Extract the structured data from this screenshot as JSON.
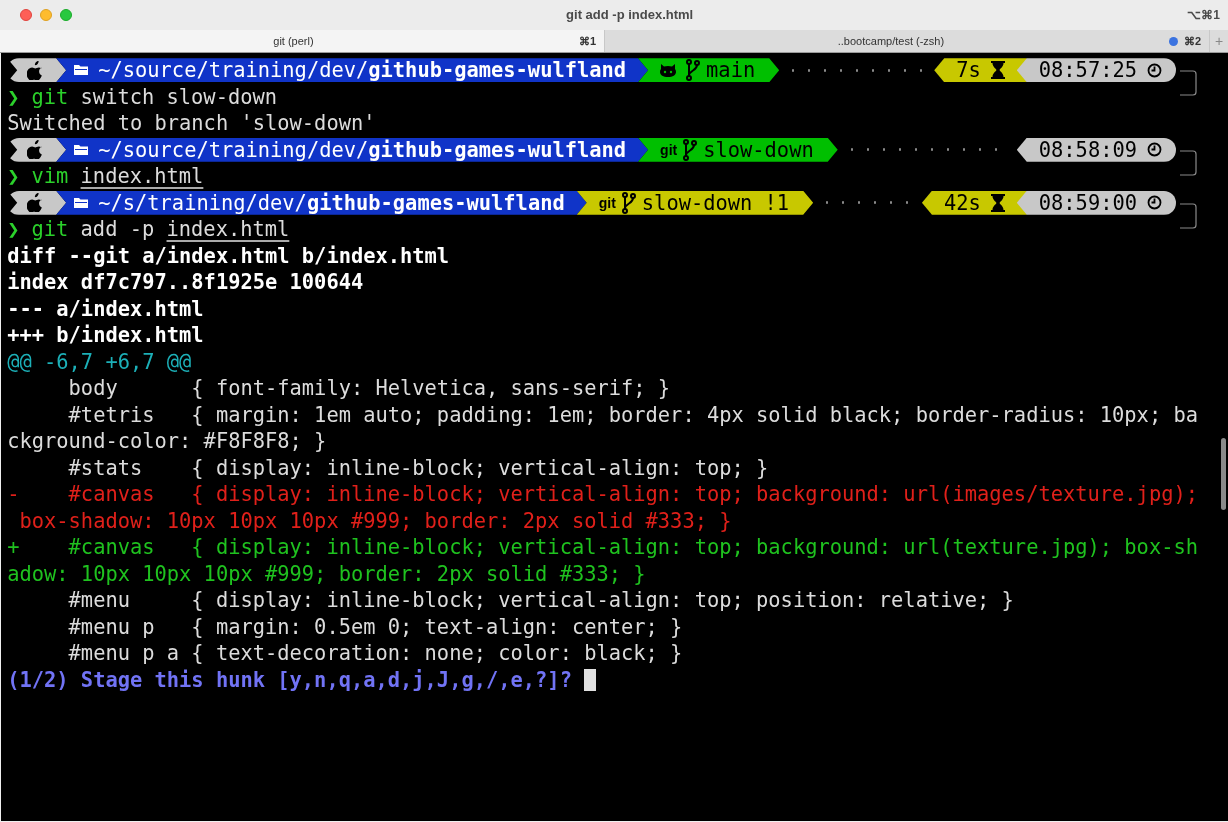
{
  "window": {
    "title": "git add -p index.html",
    "shortcut": "⌥⌘1"
  },
  "tabs": [
    {
      "label": "git (perl)",
      "shortcut": "⌘1",
      "selected": true,
      "activity": false
    },
    {
      "label": "..bootcamp/test (-zsh)",
      "shortcut": "⌘2",
      "selected": false,
      "activity": true
    }
  ],
  "new_tab": "+",
  "lines": [
    {
      "kind": "prompt",
      "path": "~/source/training/dev/**github-games-wulfland**",
      "vcs": {
        "kind": "github"
      },
      "branch": "main",
      "dirty": false,
      "duration": "7s",
      "time": "08:57:25"
    },
    {
      "kind": "command",
      "symbol": "❯",
      "program": "git",
      "args": "switch slow-down"
    },
    {
      "kind": "plain",
      "text": "Switched to branch 'slow-down'"
    },
    {
      "kind": "prompt",
      "path": "~/source/training/dev/**github-games-wulfland**",
      "vcs": {
        "kind": "text",
        "text": "git"
      },
      "branch": "slow-down",
      "dirty": false,
      "time": "08:58:09"
    },
    {
      "kind": "command",
      "symbol": "❯",
      "program": "vim",
      "file": "index.html"
    },
    {
      "kind": "prompt",
      "path": "~/s/training/dev/**github-games-wulfland**",
      "vcs": {
        "kind": "text",
        "text": "git"
      },
      "branch": "slow-down !1",
      "dirty": true,
      "duration": "42s",
      "time": "08:59:00"
    },
    {
      "kind": "command",
      "symbol": "❯",
      "program": "git",
      "args": "add -p",
      "file": "index.html"
    },
    {
      "kind": "bold",
      "text": "diff --git a/index.html b/index.html"
    },
    {
      "kind": "bold",
      "text": "index df7c797..8f1925e 100644"
    },
    {
      "kind": "bold",
      "text": "--- a/index.html"
    },
    {
      "kind": "bold",
      "text": "+++ b/index.html"
    },
    {
      "kind": "hunk",
      "text": "@@ -6,7 +6,7 @@"
    },
    {
      "kind": "plain",
      "text": "     body      { font-family: Helvetica, sans-serif; }"
    },
    {
      "kind": "plain",
      "text": "     #tetris   { margin: 1em auto; padding: 1em; border: 4px solid black; border-radius: 10px; ba"
    },
    {
      "kind": "plain",
      "text": "ckground-color: #F8F8F8; }"
    },
    {
      "kind": "plain",
      "text": "     #stats    { display: inline-block; vertical-align: top; }"
    },
    {
      "kind": "removed",
      "text": "-    #canvas   { display: inline-block; vertical-align: top; background: url(images/texture.jpg);"
    },
    {
      "kind": "removed",
      "text": " box-shadow: 10px 10px 10px #999; border: 2px solid #333; }"
    },
    {
      "kind": "added",
      "text": "+    #canvas   { display: inline-block; vertical-align: top; background: url(texture.jpg); box-sh"
    },
    {
      "kind": "added",
      "text": "adow: 10px 10px 10px #999; border: 2px solid #333; }"
    },
    {
      "kind": "plain",
      "text": "     #menu     { display: inline-block; vertical-align: top; position: relative; }"
    },
    {
      "kind": "plain",
      "text": "     #menu p   { margin: 0.5em 0; text-align: center; }"
    },
    {
      "kind": "plain",
      "text": "     #menu p a { text-decoration: none; color: black; }"
    },
    {
      "kind": "question",
      "text": "(1/2) Stage this hunk [y,n,q,a,d,j,J,g,/,e,?]?",
      "cursor": true
    }
  ]
}
